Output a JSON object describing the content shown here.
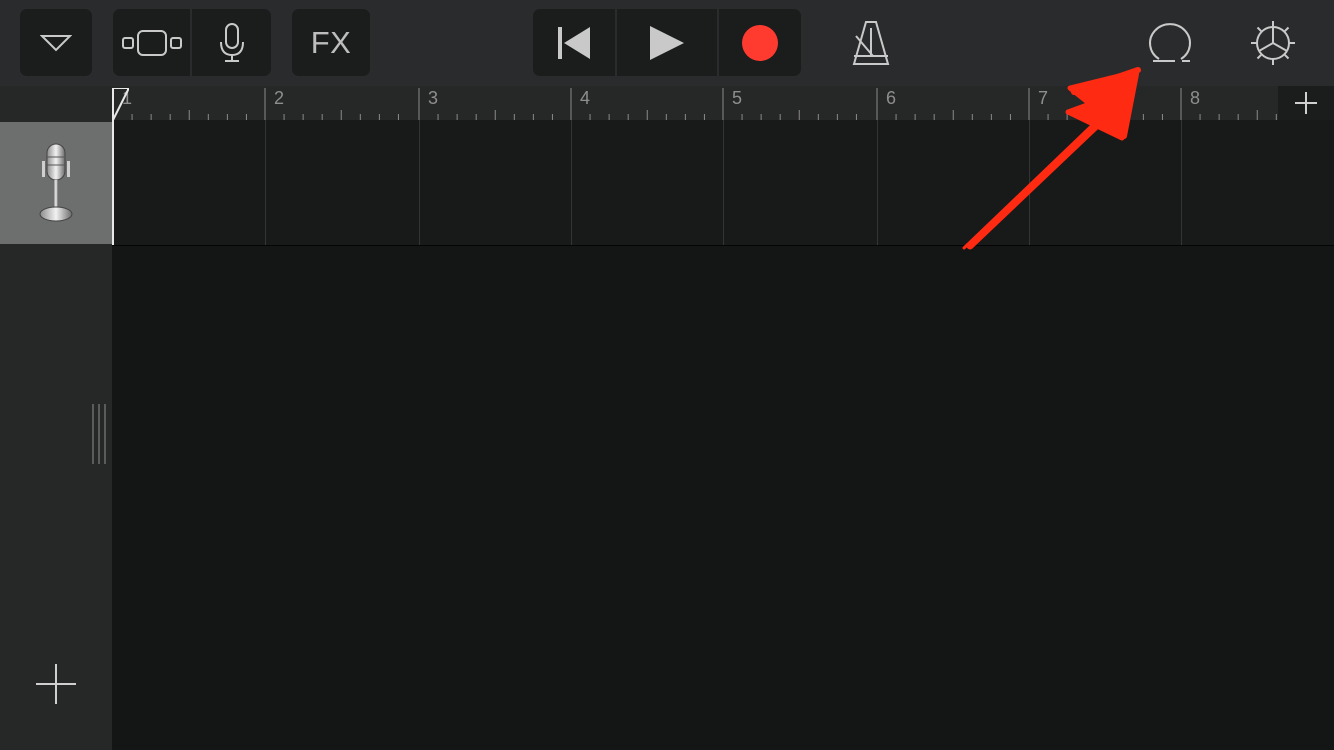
{
  "toolbar": {
    "fx_label": "FX",
    "icons": {
      "browser": "triangle-down-icon",
      "view_toggle": "view-toggle-icon",
      "input": "microphone-icon",
      "rewind": "go-to-beginning-icon",
      "play": "play-icon",
      "record": "record-icon",
      "metronome": "metronome-icon",
      "loop": "loop-browser-icon",
      "settings": "gear-icon"
    }
  },
  "ruler": {
    "bars": [
      "1",
      "2",
      "3",
      "4",
      "5",
      "6",
      "7",
      "8"
    ]
  },
  "track": {
    "instrument_icon": "vintage-microphone-icon"
  },
  "colors": {
    "record": "#ff3b30",
    "annotation_arrow": "#ff2a12",
    "toolbar_bg": "#2a2b2c",
    "button_bg": "#1b1c1c",
    "canvas_bg": "#141515"
  },
  "annotation": {
    "type": "hand-drawn-arrow",
    "points_to": "loop-browser-button"
  }
}
